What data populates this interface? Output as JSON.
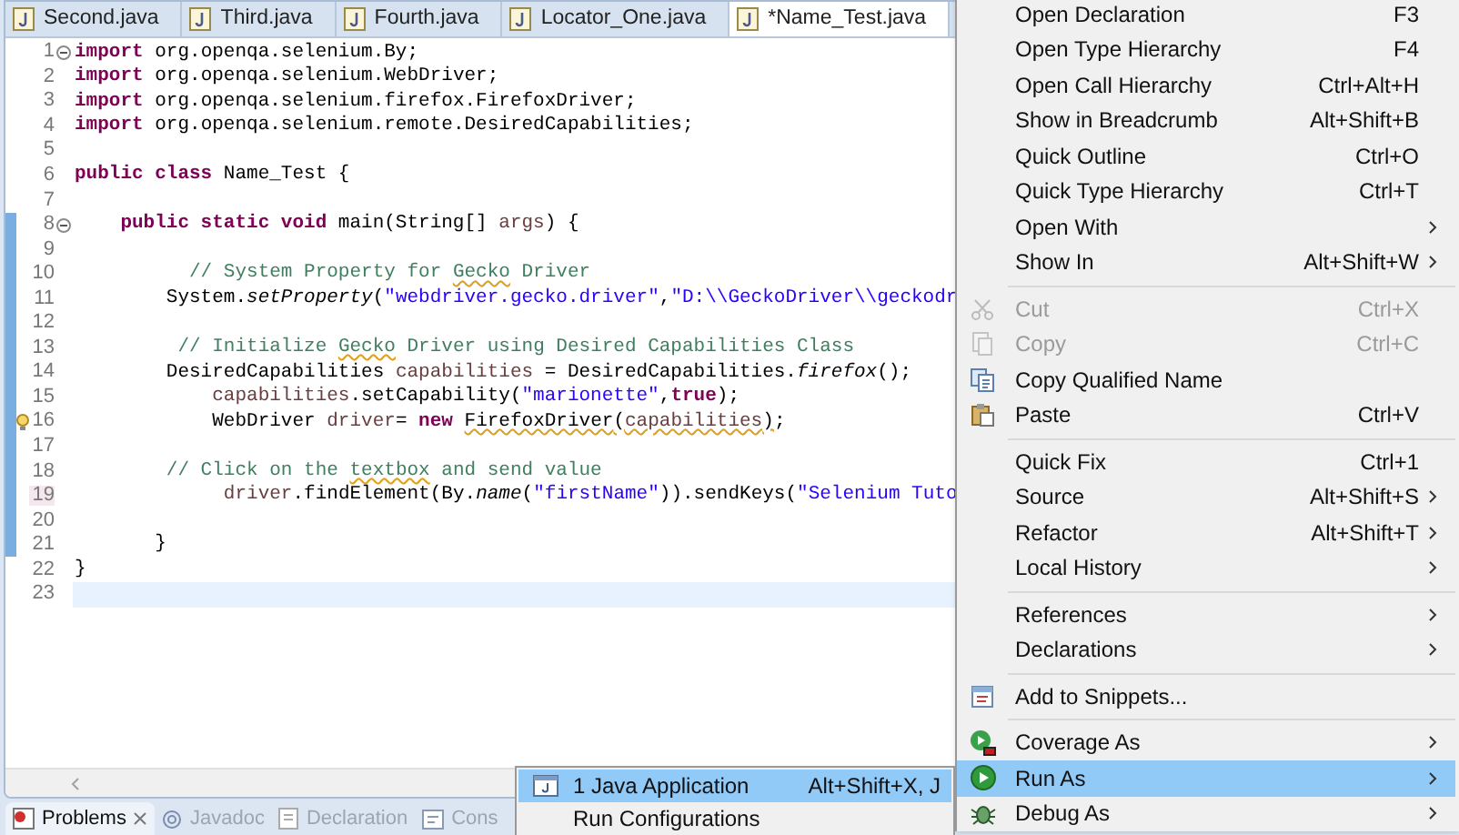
{
  "editor_tabs": [
    {
      "label": "Second.java",
      "selected": false
    },
    {
      "label": "Third.java",
      "selected": false
    },
    {
      "label": "Fourth.java",
      "selected": false
    },
    {
      "label": "Locator_One.java",
      "selected": false
    },
    {
      "label": "*Name_Test.java",
      "selected": true
    }
  ],
  "code_lines": [
    {
      "number": "1",
      "fold": true,
      "changed": false,
      "segments": [
        {
          "kind": "kw",
          "text": "import"
        },
        {
          "kind": "plain",
          "text": " org.openqa.selenium.By;"
        }
      ]
    },
    {
      "number": "2",
      "changed": false,
      "segments": [
        {
          "kind": "kw",
          "text": "import"
        },
        {
          "kind": "plain",
          "text": " org.openqa.selenium.WebDriver;"
        }
      ]
    },
    {
      "number": "3",
      "changed": false,
      "segments": [
        {
          "kind": "kw",
          "text": "import"
        },
        {
          "kind": "plain",
          "text": " org.openqa.selenium.firefox.FirefoxDriver;"
        }
      ]
    },
    {
      "number": "4",
      "changed": false,
      "segments": [
        {
          "kind": "kw",
          "text": "import"
        },
        {
          "kind": "plain",
          "text": " org.openqa.selenium.remote.DesiredCapabilities;"
        }
      ]
    },
    {
      "number": "5",
      "changed": false
    },
    {
      "number": "6",
      "changed": false,
      "segments": [
        {
          "kind": "kw",
          "text": "public class"
        },
        {
          "kind": "plain",
          "text": " Name_Test {"
        }
      ]
    },
    {
      "number": "7",
      "changed": false
    },
    {
      "number": "8",
      "fold": true,
      "changed": true,
      "segments": [
        {
          "kind": "kw",
          "text": "    public static void"
        },
        {
          "kind": "plain",
          "text": " main(String[] "
        },
        {
          "kind": "var",
          "text": "args"
        },
        {
          "kind": "plain",
          "text": ") {"
        }
      ]
    },
    {
      "number": "9",
      "changed": true
    },
    {
      "number": "10",
      "changed": true,
      "segments": [
        {
          "kind": "comment",
          "text": "          // System Property for "
        },
        {
          "kind": "comment",
          "text": "Gecko",
          "squiggle": true
        },
        {
          "kind": "comment",
          "text": " Driver"
        }
      ]
    },
    {
      "number": "11",
      "changed": true,
      "segments": [
        {
          "kind": "plain",
          "text": "        System."
        },
        {
          "kind": "italic",
          "text": "setProperty"
        },
        {
          "kind": "plain",
          "text": "("
        },
        {
          "kind": "str",
          "text": "\"webdriver.gecko.driver\""
        },
        {
          "kind": "plain",
          "text": ","
        },
        {
          "kind": "str",
          "text": "\"D:\\\\GeckoDriver\\\\geckodr"
        }
      ]
    },
    {
      "number": "12",
      "changed": true
    },
    {
      "number": "13",
      "changed": true,
      "segments": [
        {
          "kind": "comment",
          "text": "         // Initialize "
        },
        {
          "kind": "comment",
          "text": "Gecko",
          "squiggle": true
        },
        {
          "kind": "comment",
          "text": " Driver using Desired Capabilities Class"
        }
      ]
    },
    {
      "number": "14",
      "changed": true,
      "segments": [
        {
          "kind": "plain",
          "text": "        DesiredCapabilities "
        },
        {
          "kind": "var",
          "text": "capabilities"
        },
        {
          "kind": "plain",
          "text": " = DesiredCapabilities."
        },
        {
          "kind": "italic",
          "text": "firefox"
        },
        {
          "kind": "plain",
          "text": "();"
        }
      ]
    },
    {
      "number": "15",
      "changed": true,
      "segments": [
        {
          "kind": "var",
          "text": "            capabilities"
        },
        {
          "kind": "plain",
          "text": ".setCapability("
        },
        {
          "kind": "str",
          "text": "\"marionette\""
        },
        {
          "kind": "plain",
          "text": ","
        },
        {
          "kind": "kw",
          "text": "true"
        },
        {
          "kind": "plain",
          "text": ");"
        }
      ]
    },
    {
      "number": "16",
      "changed": true,
      "warning": true,
      "segments": [
        {
          "kind": "plain",
          "text": "            WebDriver "
        },
        {
          "kind": "var",
          "text": "driver"
        },
        {
          "kind": "plain",
          "text": "= "
        },
        {
          "kind": "kw",
          "text": "new "
        },
        {
          "kind": "deprecated",
          "text": "FirefoxDriver",
          "squiggle": true
        },
        {
          "kind": "plain",
          "text": "(",
          "squiggle": true
        },
        {
          "kind": "var",
          "text": "capabilities",
          "squiggle": true
        },
        {
          "kind": "plain",
          "text": ")",
          "squiggle": true
        },
        {
          "kind": "plain",
          "text": ";"
        }
      ]
    },
    {
      "number": "17",
      "changed": true
    },
    {
      "number": "18",
      "changed": true,
      "segments": [
        {
          "kind": "comment",
          "text": "        // Click on the "
        },
        {
          "kind": "comment",
          "text": "textbox",
          "squiggle": true
        },
        {
          "kind": "comment",
          "text": " and send value"
        }
      ]
    },
    {
      "number": "19",
      "changed": true,
      "marked": true,
      "segments": [
        {
          "kind": "var",
          "text": "             driver"
        },
        {
          "kind": "plain",
          "text": ".findElement(By."
        },
        {
          "kind": "italic",
          "text": "name"
        },
        {
          "kind": "plain",
          "text": "("
        },
        {
          "kind": "str",
          "text": "\"firstName\""
        },
        {
          "kind": "plain",
          "text": ")).sendKeys("
        },
        {
          "kind": "str",
          "text": "\"Selenium Tuto"
        }
      ]
    },
    {
      "number": "20",
      "changed": true
    },
    {
      "number": "21",
      "changed": true,
      "segments": [
        {
          "kind": "plain",
          "text": "       }"
        }
      ]
    },
    {
      "number": "22",
      "changed": false,
      "segments": [
        {
          "kind": "plain",
          "text": "}"
        }
      ]
    },
    {
      "number": "23",
      "changed": false,
      "current": true
    }
  ],
  "context_menu": {
    "groups": [
      [
        {
          "label": "Open Declaration",
          "shortcut": "F3",
          "submenu": false,
          "disabled": false,
          "selected": false
        },
        {
          "label": "Open Type Hierarchy",
          "shortcut": "F4",
          "submenu": false,
          "disabled": false,
          "selected": false
        },
        {
          "label": "Open Call Hierarchy",
          "shortcut": "Ctrl+Alt+H",
          "submenu": false,
          "disabled": false,
          "selected": false
        },
        {
          "label": "Show in Breadcrumb",
          "shortcut": "Alt+Shift+B",
          "submenu": false,
          "disabled": false,
          "selected": false
        },
        {
          "label": "Quick Outline",
          "shortcut": "Ctrl+O",
          "submenu": false,
          "disabled": false,
          "selected": false
        },
        {
          "label": "Quick Type Hierarchy",
          "shortcut": "Ctrl+T",
          "submenu": false,
          "disabled": false,
          "selected": false
        },
        {
          "label": "Open With",
          "submenu": true,
          "disabled": false,
          "selected": false
        },
        {
          "label": "Show In",
          "shortcut": "Alt+Shift+W",
          "submenu": true,
          "disabled": false,
          "selected": false
        }
      ],
      [
        {
          "label": "Cut",
          "shortcut": "Ctrl+X",
          "kind": "cut",
          "submenu": false,
          "disabled": true,
          "selected": false
        },
        {
          "label": "Copy",
          "shortcut": "Ctrl+C",
          "kind": "copy",
          "submenu": false,
          "disabled": true,
          "selected": false
        },
        {
          "label": "Copy Qualified Name",
          "kind": "copyname",
          "submenu": false,
          "disabled": false,
          "selected": false
        },
        {
          "label": "Paste",
          "shortcut": "Ctrl+V",
          "kind": "paste",
          "submenu": false,
          "disabled": false,
          "selected": false
        }
      ],
      [
        {
          "label": "Quick Fix",
          "shortcut": "Ctrl+1",
          "submenu": false,
          "disabled": false,
          "selected": false
        },
        {
          "label": "Source",
          "shortcut": "Alt+Shift+S",
          "submenu": true,
          "disabled": false,
          "selected": false
        },
        {
          "label": "Refactor",
          "shortcut": "Alt+Shift+T",
          "submenu": true,
          "disabled": false,
          "selected": false
        },
        {
          "label": "Local History",
          "submenu": true,
          "disabled": false,
          "selected": false
        }
      ],
      [
        {
          "label": "References",
          "submenu": true,
          "disabled": false,
          "selected": false
        },
        {
          "label": "Declarations",
          "submenu": true,
          "disabled": false,
          "selected": false
        }
      ],
      [
        {
          "label": "Add to Snippets...",
          "kind": "snippet",
          "submenu": false,
          "disabled": false,
          "selected": false
        }
      ],
      [
        {
          "label": "Coverage As",
          "kind": "coverage",
          "submenu": true,
          "disabled": false,
          "selected": false
        },
        {
          "label": "Run As",
          "kind": "run",
          "submenu": true,
          "disabled": false,
          "selected": true
        },
        {
          "label": "Debug As",
          "kind": "debug",
          "submenu": true,
          "disabled": false,
          "selected": false
        }
      ]
    ]
  },
  "run_as_submenu": [
    {
      "label": "1 Java Application",
      "shortcut": "Alt+Shift+X, J",
      "selected": true
    },
    {
      "label": "Run Configurations",
      "selected": false
    }
  ],
  "bottom_tabs": [
    {
      "label": "Problems",
      "selected": true
    },
    {
      "label": "Javadoc",
      "selected": false
    },
    {
      "label": "Declaration",
      "selected": false
    },
    {
      "label": "Cons",
      "selected": false
    }
  ]
}
